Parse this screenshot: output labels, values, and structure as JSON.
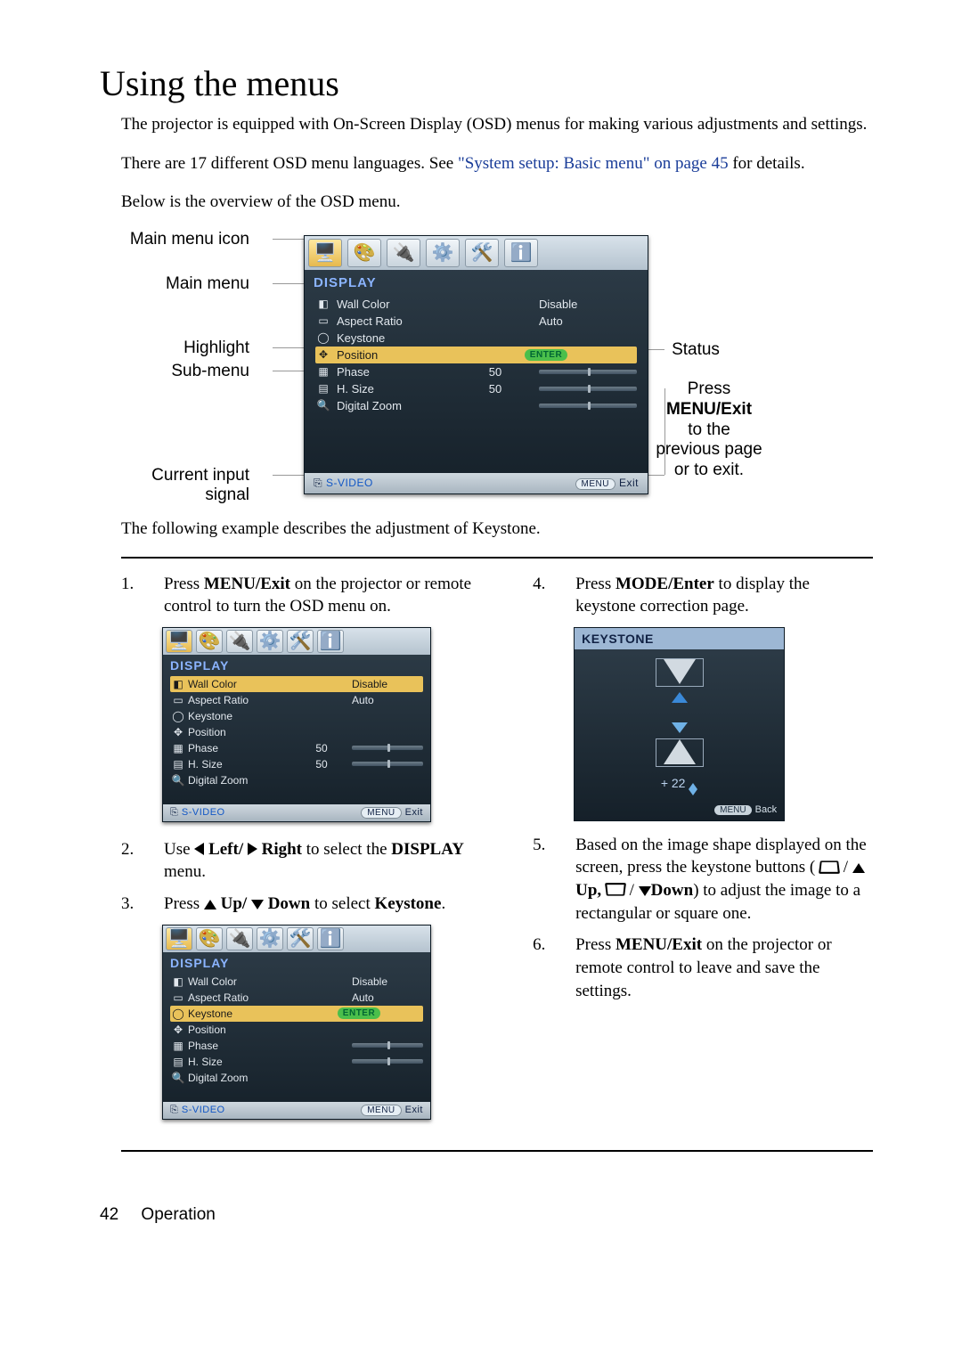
{
  "heading": "Using the menus",
  "intro1": "The projector is equipped with On-Screen Display (OSD) menus for making various adjustments and settings.",
  "intro2_a": "There are 17 different OSD menu languages. See ",
  "intro2_link": "\"System setup: Basic menu\" on page 45",
  "intro2_b": " for details.",
  "intro3": "Below is the overview of the OSD menu.",
  "annot": {
    "main_menu_icon": "Main menu icon",
    "main_menu": "Main menu",
    "highlight": "Highlight",
    "sub_menu": "Sub-menu",
    "current_input": "Current input signal",
    "status": "Status",
    "press_line1": "Press",
    "press_line2": "MENU/Exit",
    "press_line3": "to the previous page or to exit."
  },
  "osd": {
    "title": "DISPLAY",
    "items": [
      {
        "label": "Wall Color",
        "value": "Disable",
        "type": "text"
      },
      {
        "label": "Aspect Ratio",
        "value": "Auto",
        "type": "text"
      },
      {
        "label": "Keystone",
        "value": "",
        "type": "none"
      },
      {
        "label": "Position",
        "value": "ENTER",
        "type": "enter"
      },
      {
        "label": "Phase",
        "value": "50",
        "type": "slider"
      },
      {
        "label": "H. Size",
        "value": "50",
        "type": "slider"
      },
      {
        "label": "Digital Zoom",
        "value": "",
        "type": "slider-nolabel"
      }
    ],
    "footer_source": "S-VIDEO",
    "footer_menu": "MENU",
    "footer_exit": "Exit"
  },
  "after_diagram_text": "The following example describes the adjustment of Keystone.",
  "steps": {
    "s1_a": "Press ",
    "s1_b": "MENU/Exit",
    "s1_c": " on the projector or remote control to turn the OSD menu on.",
    "s2_a": "Use ",
    "s2_left": " Left/ ",
    "s2_right": " Right",
    "s2_b": " to select the ",
    "s2_c": "DISPLAY",
    "s2_d": " menu.",
    "s3_a": "Press ",
    "s3_up": " Up/ ",
    "s3_down": " Down",
    "s3_b": " to select ",
    "s3_c": "Keystone",
    "s3_d": ".",
    "s4_a": "Press ",
    "s4_b": "MODE/Enter",
    "s4_c": " to display the keystone correction page.",
    "s5_a": "Based on the image shape displayed on the screen, press the keystone buttons (",
    "s5_b": "Up,",
    "s5_c": "Down",
    "s5_d": ") to adjust the image to a rectangular or square one.",
    "s6_a": "Press ",
    "s6_b": "MENU/Exit",
    "s6_c": " on the projector or remote control to leave and save the settings."
  },
  "osd_step3": {
    "items": [
      {
        "label": "Wall Color",
        "value": "Disable",
        "type": "text"
      },
      {
        "label": "Aspect Ratio",
        "value": "Auto",
        "type": "text"
      },
      {
        "label": "Keystone",
        "value": "ENTER",
        "type": "enter",
        "highlight": true
      },
      {
        "label": "Position",
        "value": "",
        "type": "none"
      },
      {
        "label": "Phase",
        "value": "",
        "type": "slider-nolabel"
      },
      {
        "label": "H. Size",
        "value": "",
        "type": "slider-nolabel"
      },
      {
        "label": "Digital Zoom",
        "value": "",
        "type": "slider-nolabel"
      }
    ]
  },
  "keystone": {
    "title": "KEYSTONE",
    "value": "+ 22",
    "footer_menu": "MENU",
    "footer_back": "Back"
  },
  "page_footer": {
    "number": "42",
    "section": "Operation"
  }
}
